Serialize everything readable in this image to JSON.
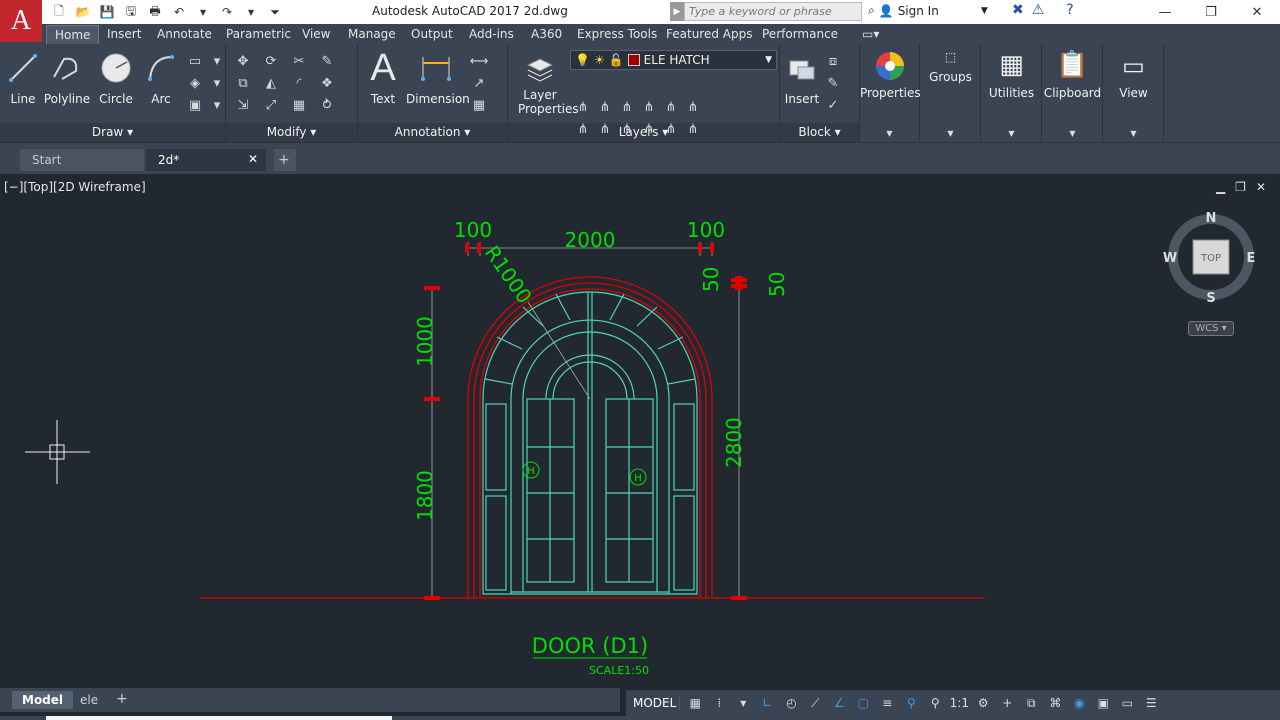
{
  "app": {
    "logo_letter": "A",
    "title": "Autodesk AutoCAD 2017   2d.dwg",
    "search_placeholder": "Type a keyword or phrase",
    "signin_label": "Sign In"
  },
  "ribbon_tabs": [
    "Home",
    "Insert",
    "Annotate",
    "Parametric",
    "View",
    "Manage",
    "Output",
    "Add-ins",
    "A360",
    "Express Tools",
    "Featured Apps",
    "Performance"
  ],
  "ribbon": {
    "draw": {
      "title": "Draw",
      "line": "Line",
      "polyline": "Polyline",
      "circle": "Circle",
      "arc": "Arc"
    },
    "modify": {
      "title": "Modify"
    },
    "annotation": {
      "title": "Annotation",
      "text": "Text",
      "dimension": "Dimension"
    },
    "layers": {
      "title": "Layers",
      "layer_properties_1": "Layer",
      "layer_properties_2": "Properties",
      "current_layer": "ELE HATCH"
    },
    "block": {
      "title": "Block",
      "insert": "Insert"
    },
    "properties": "Properties",
    "groups": "Groups",
    "utilities": "Utilities",
    "clipboard": "Clipboard",
    "view": "View"
  },
  "file_tabs": {
    "start": "Start",
    "active": "2d*"
  },
  "viewport": {
    "label": "[−][Top][2D Wireframe]",
    "viewcube": {
      "n": "N",
      "s": "S",
      "e": "E",
      "w": "W",
      "face": "TOP",
      "wcs": "WCS"
    }
  },
  "drawing": {
    "dims": {
      "left_offset": "100",
      "width": "2000",
      "right_offset": "100",
      "radius": "R1000",
      "top_50_a": "50",
      "top_50_b": "50",
      "arch_height": "1000",
      "door_height": "1800",
      "total_height": "2800"
    },
    "handle_mark": "H",
    "title": "DOOR (D1)",
    "scale": "SCALE1:50"
  },
  "layout_tabs": {
    "model": "Model",
    "layout1": "ele"
  },
  "status": {
    "space": "MODEL",
    "scale": "1:1"
  },
  "colors": {
    "dim_green": "#00e000",
    "door_cyan": "#4fd6b4",
    "arch_red": "#e00000",
    "background": "#212830"
  }
}
